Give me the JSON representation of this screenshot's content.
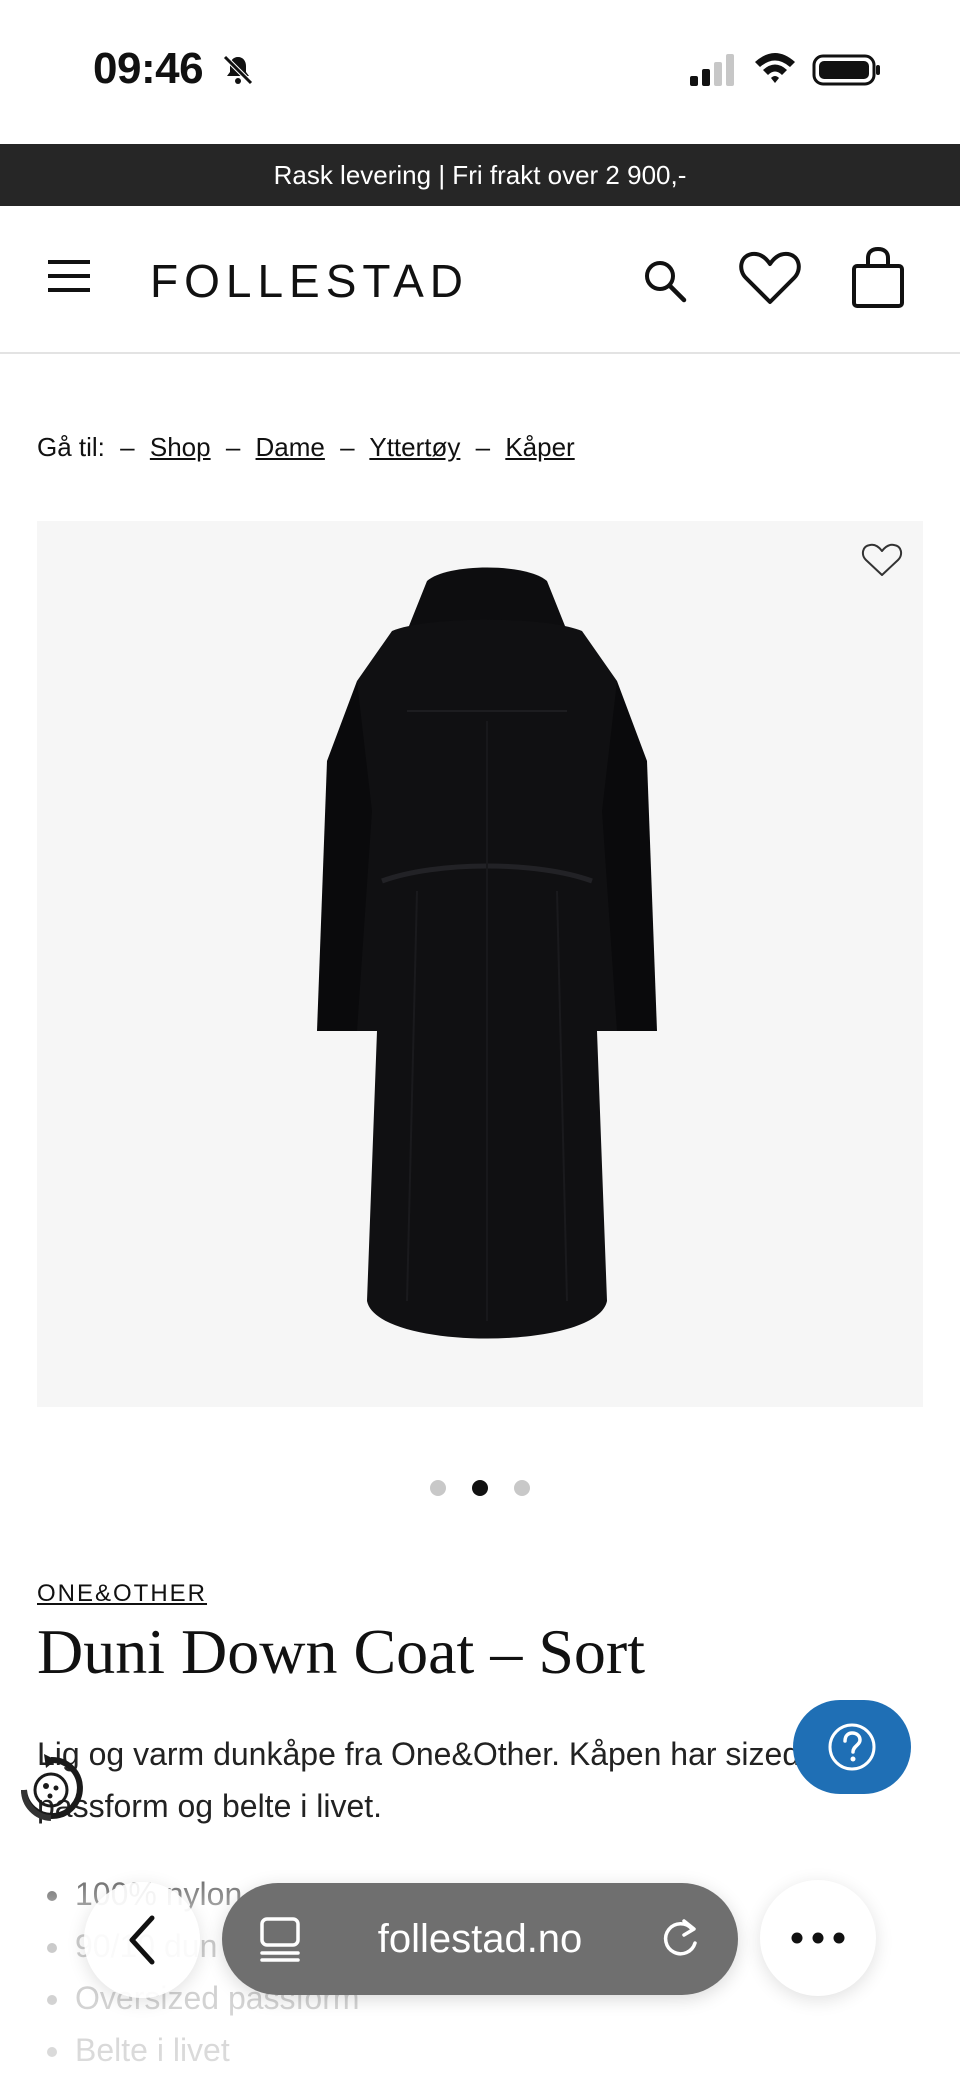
{
  "status_bar": {
    "time": "09:46"
  },
  "promo": {
    "text": "Rask levering | Fri frakt over 2 900,-"
  },
  "header": {
    "logo": "FOLLESTAD"
  },
  "breadcrumb": {
    "prefix": "Gå til:",
    "separator": "–",
    "items": [
      "Shop",
      "Dame",
      "Yttertøy",
      "Kåper"
    ]
  },
  "product": {
    "brand": "ONE&OTHER",
    "title": "Duni Down Coat – Sort",
    "description": "Lig og varm dunkåpe fra One&Other. Kåpen har sized passform og belte i livet.",
    "features": [
      "100% nylon",
      "90/10 dun",
      "Oversized passform",
      "Belte i livet"
    ],
    "image_count": 3,
    "active_image": 2
  },
  "browser": {
    "url": "follestad.no"
  },
  "colors": {
    "promo_bg": "#262626",
    "help_button": "#1f6fb5",
    "url_pill": "#6f6f6f"
  }
}
